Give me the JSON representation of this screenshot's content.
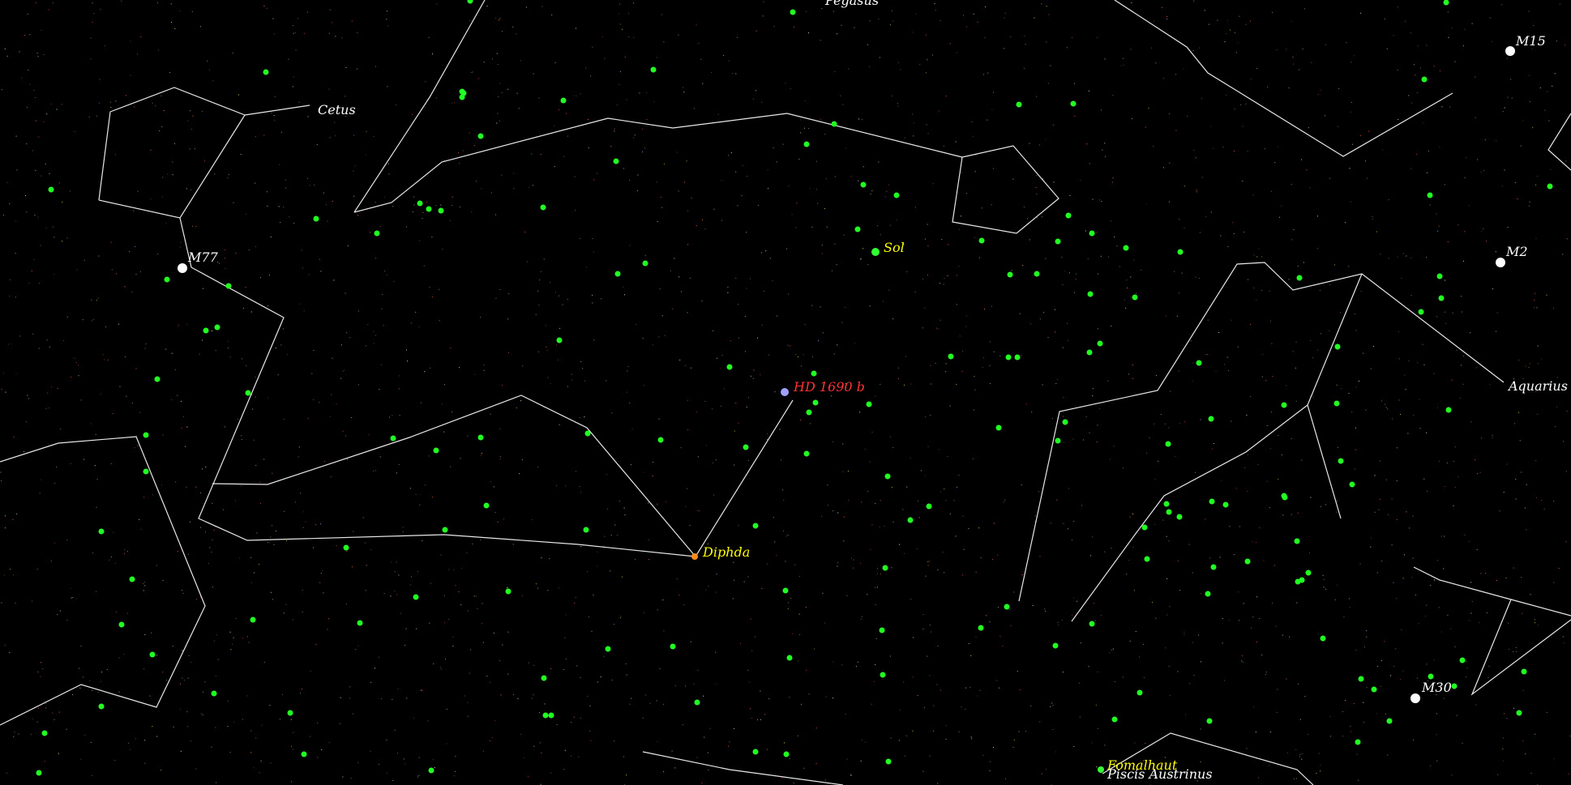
{
  "constellations": [
    {
      "name": "Cetus",
      "label_pos": "top-left"
    },
    {
      "name": "Pegasus",
      "label_pos": "top-center"
    },
    {
      "name": "Aquarius",
      "label_pos": "right"
    },
    {
      "name": "Piscis Austrinus",
      "label_pos": "bottom-right"
    }
  ],
  "named_stars": [
    {
      "name": "Sol",
      "color": "#ffff00"
    },
    {
      "name": "Diphda",
      "color": "#ff8c1a"
    },
    {
      "name": "Fomalhaut",
      "color": "#ffff00"
    }
  ],
  "planet": {
    "name": "HD 1690 b",
    "color": "#ff3333",
    "marker_color": "#a0a0ff"
  },
  "deep_sky_objects": [
    {
      "name": "M77"
    },
    {
      "name": "M15"
    },
    {
      "name": "M2"
    },
    {
      "name": "M30"
    }
  ],
  "colors": {
    "background": "#000000",
    "constellation_lines": "#e8e8e8",
    "field_stars": "#22ff22",
    "dso_marker": "#ffffff"
  }
}
